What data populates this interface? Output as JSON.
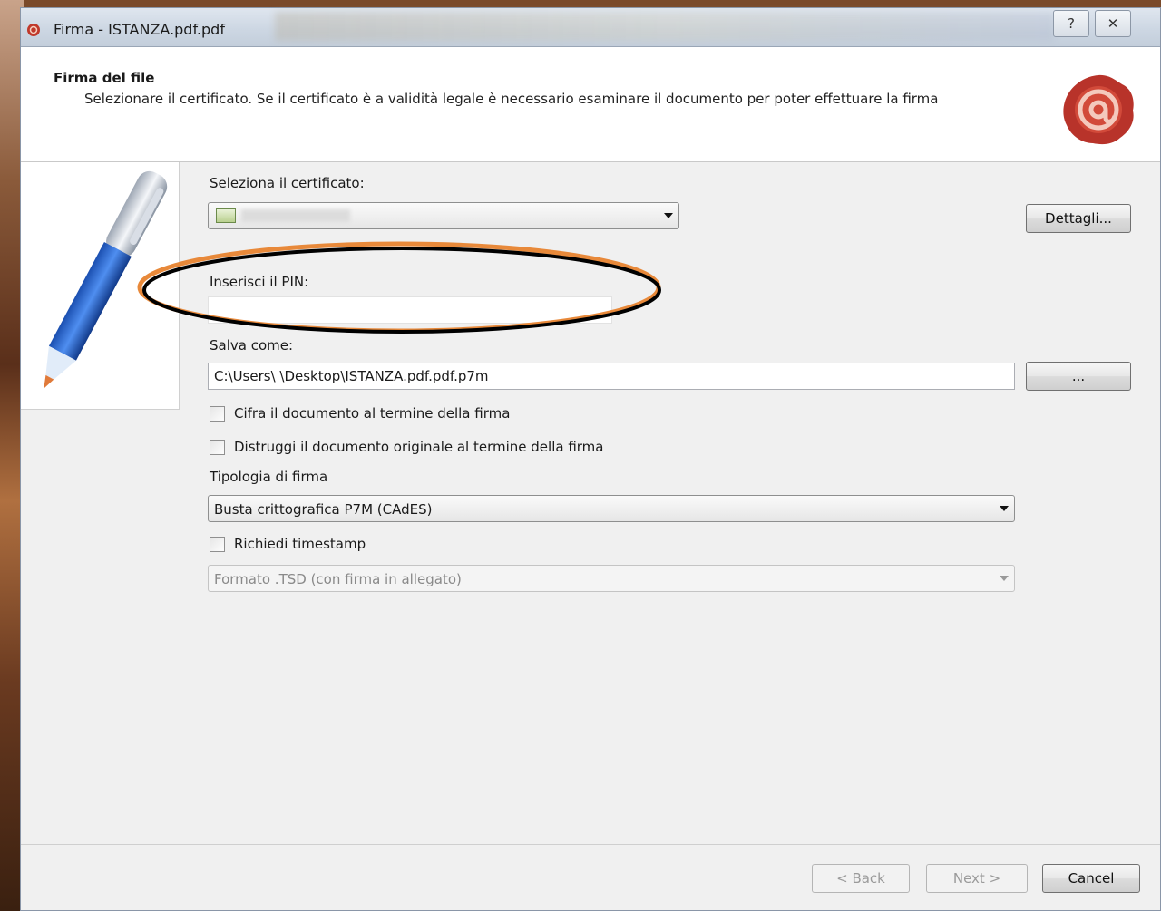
{
  "window": {
    "title": "Firma - ISTANZA.pdf.pdf",
    "help_icon": "?",
    "close_icon": "✕"
  },
  "header": {
    "title": "Firma del file",
    "subtitle": "Selezionare il certificato. Se il certificato è a validità legale è necessario esaminare il documento per poter effettuare la firma"
  },
  "form": {
    "certificate_label": "Seleziona il certificato:",
    "details_button": "Dettagli...",
    "pin_label": "Inserisci il PIN:",
    "pin_value": "",
    "save_as_label": "Salva come:",
    "save_path": "C:\\Users\\        \\Desktop\\ISTANZA.pdf.pdf.p7m",
    "browse_button": "...",
    "encrypt_checkbox": "Cifra il documento al termine della firma",
    "destroy_checkbox": "Distruggi il documento originale al termine della firma",
    "signature_type_label": "Tipologia di firma",
    "signature_type_value": "Busta crittografica P7M (CAdES)",
    "timestamp_checkbox": "Richiedi timestamp",
    "timestamp_format_value": "Formato .TSD (con firma in allegato)"
  },
  "footer": {
    "back_button": "< Back",
    "next_button": "Next >",
    "cancel_button": "Cancel"
  },
  "colors": {
    "highlight_outer": "#e8893a",
    "highlight_inner": "#000000",
    "seal": "#c0392b"
  }
}
